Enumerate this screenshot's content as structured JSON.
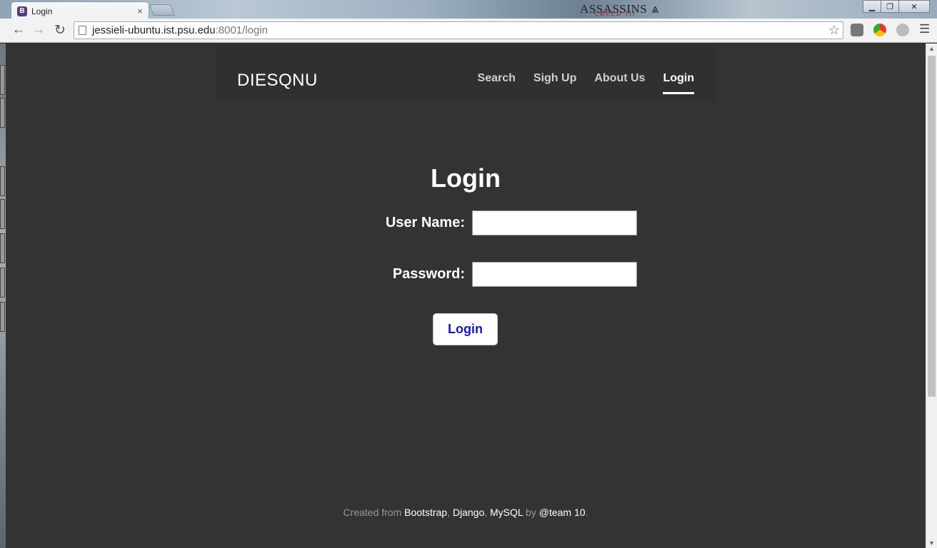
{
  "browser": {
    "tab_title": "Login",
    "tab_favicon": "B",
    "tab_close": "×",
    "url_host": "jessieli-ubuntu.ist.psu.edu",
    "url_rest": ":8001/login",
    "theme_logo": "ASSASSINS",
    "theme_logo_sub": "CREED III"
  },
  "site": {
    "brand": "DIESQNU",
    "nav": [
      {
        "label": "Search"
      },
      {
        "label": "Sigh Up"
      },
      {
        "label": "About Us"
      },
      {
        "label": "Login",
        "active": true
      }
    ]
  },
  "login": {
    "title": "Login",
    "username_label": "User Name:",
    "username_value": "",
    "password_label": "Password:",
    "password_value": "",
    "submit_label": "Login"
  },
  "footer": {
    "prefix": "Created from ",
    "link1": "Bootstrap",
    "sep1": ", ",
    "link2": "Django",
    "sep2": ", ",
    "link3": "MySQL",
    "by": " by ",
    "link4": "@team 10",
    "end": "."
  },
  "colors": {
    "page_bg": "#333333",
    "masthead_bg": "#303030",
    "button_text": "#1515b8"
  }
}
